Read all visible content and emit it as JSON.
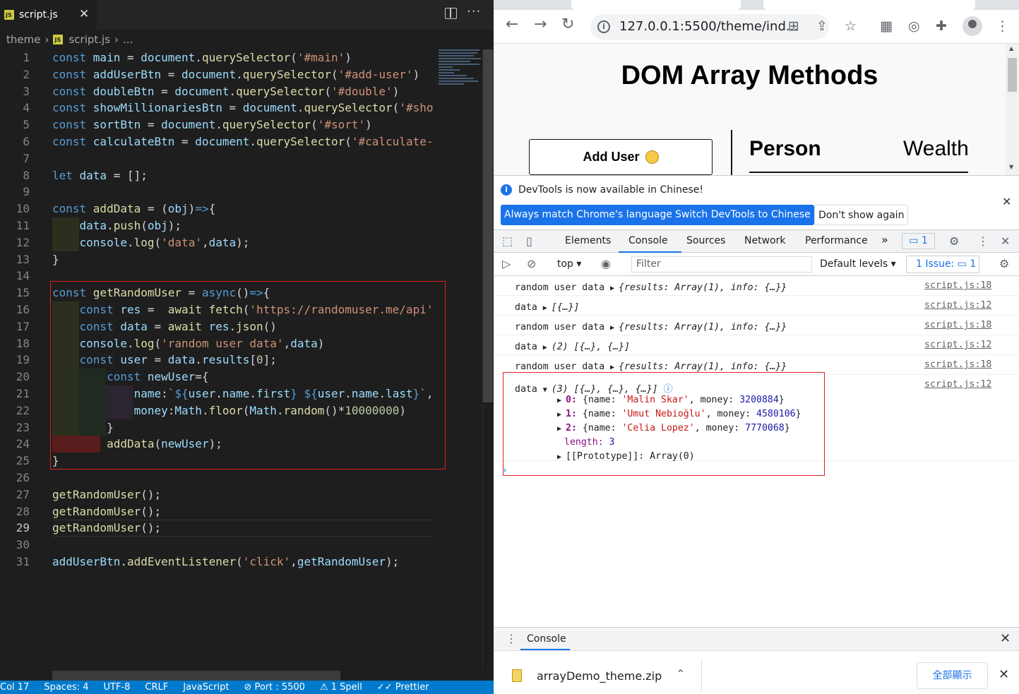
{
  "editor": {
    "tab": {
      "icon": "JS",
      "label": "script.js",
      "close": "✕"
    },
    "breadcrumb": {
      "folder": "theme",
      "file": "script.js",
      "more": "..."
    },
    "current_line": 29,
    "lines": [
      [
        [
          "k",
          "const "
        ],
        [
          "v",
          "main"
        ],
        [
          "p",
          " = "
        ],
        [
          "v",
          "document"
        ],
        [
          "p",
          "."
        ],
        [
          "f",
          "querySelector"
        ],
        [
          "p",
          "("
        ],
        [
          "s",
          "'#main'"
        ],
        [
          "p",
          ")"
        ]
      ],
      [
        [
          "k",
          "const "
        ],
        [
          "v",
          "addUserBtn"
        ],
        [
          "p",
          " = "
        ],
        [
          "v",
          "document"
        ],
        [
          "p",
          "."
        ],
        [
          "f",
          "querySelector"
        ],
        [
          "p",
          "("
        ],
        [
          "s",
          "'#add-user'"
        ],
        [
          "p",
          ")"
        ]
      ],
      [
        [
          "k",
          "const "
        ],
        [
          "v",
          "doubleBtn"
        ],
        [
          "p",
          " = "
        ],
        [
          "v",
          "document"
        ],
        [
          "p",
          "."
        ],
        [
          "f",
          "querySelector"
        ],
        [
          "p",
          "("
        ],
        [
          "s",
          "'#double'"
        ],
        [
          "p",
          ")"
        ]
      ],
      [
        [
          "k",
          "const "
        ],
        [
          "v",
          "showMillionariesBtn"
        ],
        [
          "p",
          " = "
        ],
        [
          "v",
          "document"
        ],
        [
          "p",
          "."
        ],
        [
          "f",
          "querySelector"
        ],
        [
          "p",
          "("
        ],
        [
          "s",
          "'#show"
        ]
      ],
      [
        [
          "k",
          "const "
        ],
        [
          "v",
          "sortBtn"
        ],
        [
          "p",
          " = "
        ],
        [
          "v",
          "document"
        ],
        [
          "p",
          "."
        ],
        [
          "f",
          "querySelector"
        ],
        [
          "p",
          "("
        ],
        [
          "s",
          "'#sort'"
        ],
        [
          "p",
          ")"
        ]
      ],
      [
        [
          "k",
          "const "
        ],
        [
          "v",
          "calculateBtn"
        ],
        [
          "p",
          " = "
        ],
        [
          "v",
          "document"
        ],
        [
          "p",
          "."
        ],
        [
          "f",
          "querySelector"
        ],
        [
          "p",
          "("
        ],
        [
          "s",
          "'#calculate-"
        ]
      ],
      [],
      [
        [
          "k",
          "let "
        ],
        [
          "v",
          "data"
        ],
        [
          "p",
          " = [];"
        ]
      ],
      [],
      [
        [
          "k",
          "const "
        ],
        [
          "f",
          "addData"
        ],
        [
          "p",
          " = ("
        ],
        [
          "v",
          "obj"
        ],
        [
          "p",
          ")"
        ],
        [
          "k",
          "=>"
        ],
        [
          "p",
          "{"
        ]
      ],
      [
        [
          "p",
          "    "
        ],
        [
          "v",
          "data"
        ],
        [
          "p",
          "."
        ],
        [
          "f",
          "push"
        ],
        [
          "p",
          "("
        ],
        [
          "v",
          "obj"
        ],
        [
          "p",
          ");"
        ]
      ],
      [
        [
          "p",
          "    "
        ],
        [
          "v",
          "console"
        ],
        [
          "p",
          "."
        ],
        [
          "f",
          "log"
        ],
        [
          "p",
          "("
        ],
        [
          "s",
          "'data'"
        ],
        [
          "p",
          ","
        ],
        [
          "v",
          "data"
        ],
        [
          "p",
          ");"
        ]
      ],
      [
        [
          "p",
          "}"
        ]
      ],
      [],
      [
        [
          "k",
          "const "
        ],
        [
          "f",
          "getRandomUser"
        ],
        [
          "p",
          " = "
        ],
        [
          "k",
          "async"
        ],
        [
          "p",
          "()"
        ],
        [
          "k",
          "=>"
        ],
        [
          "p",
          "{"
        ]
      ],
      [
        [
          "p",
          "    "
        ],
        [
          "k",
          "const "
        ],
        [
          "v",
          "res"
        ],
        [
          "p",
          " =  "
        ],
        [
          "f",
          "await "
        ],
        [
          "f",
          "fetch"
        ],
        [
          "p",
          "("
        ],
        [
          "s",
          "'https://randomuser.me/api'"
        ]
      ],
      [
        [
          "p",
          "    "
        ],
        [
          "k",
          "const "
        ],
        [
          "v",
          "data"
        ],
        [
          "p",
          " = "
        ],
        [
          "f",
          "await "
        ],
        [
          "v",
          "res"
        ],
        [
          "p",
          "."
        ],
        [
          "f",
          "json"
        ],
        [
          "p",
          "()"
        ]
      ],
      [
        [
          "p",
          "    "
        ],
        [
          "v",
          "console"
        ],
        [
          "p",
          "."
        ],
        [
          "f",
          "log"
        ],
        [
          "p",
          "("
        ],
        [
          "s",
          "'random user data'"
        ],
        [
          "p",
          ","
        ],
        [
          "v",
          "data"
        ],
        [
          "p",
          ")"
        ]
      ],
      [
        [
          "p",
          "    "
        ],
        [
          "k",
          "const "
        ],
        [
          "v",
          "user"
        ],
        [
          "p",
          " = "
        ],
        [
          "v",
          "data"
        ],
        [
          "p",
          "."
        ],
        [
          "v",
          "results"
        ],
        [
          "p",
          "["
        ],
        [
          "n",
          "0"
        ],
        [
          "p",
          "];"
        ]
      ],
      [
        [
          "p",
          "        "
        ],
        [
          "k",
          "const "
        ],
        [
          "v",
          "newUser"
        ],
        [
          "p",
          "={"
        ]
      ],
      [
        [
          "p",
          "            "
        ],
        [
          "v",
          "name"
        ],
        [
          "p",
          ":"
        ],
        [
          "s",
          "`"
        ],
        [
          "k",
          "${"
        ],
        [
          "v",
          "user"
        ],
        [
          "p",
          "."
        ],
        [
          "v",
          "name"
        ],
        [
          "p",
          "."
        ],
        [
          "v",
          "first"
        ],
        [
          "k",
          "}"
        ],
        [
          "s",
          " "
        ],
        [
          "k",
          "${"
        ],
        [
          "v",
          "user"
        ],
        [
          "p",
          "."
        ],
        [
          "v",
          "name"
        ],
        [
          "p",
          "."
        ],
        [
          "v",
          "last"
        ],
        [
          "k",
          "}"
        ],
        [
          "s",
          "`"
        ],
        [
          "p",
          ","
        ]
      ],
      [
        [
          "p",
          "            "
        ],
        [
          "v",
          "money"
        ],
        [
          "p",
          ":"
        ],
        [
          "v",
          "Math"
        ],
        [
          "p",
          "."
        ],
        [
          "f",
          "floor"
        ],
        [
          "p",
          "("
        ],
        [
          "v",
          "Math"
        ],
        [
          "p",
          "."
        ],
        [
          "f",
          "random"
        ],
        [
          "p",
          "()*"
        ],
        [
          "n",
          "10000000"
        ],
        [
          "p",
          ")"
        ]
      ],
      [
        [
          "p",
          "        }"
        ]
      ],
      [
        [
          "p",
          "        "
        ],
        [
          "f",
          "addData"
        ],
        [
          "p",
          "("
        ],
        [
          "v",
          "newUser"
        ],
        [
          "p",
          ");"
        ]
      ],
      [
        [
          "p",
          "}"
        ]
      ],
      [],
      [
        [
          "f",
          "getRandomUser"
        ],
        [
          "p",
          "();"
        ]
      ],
      [
        [
          "f",
          "getRandomUser"
        ],
        [
          "p",
          "();"
        ]
      ],
      [
        [
          "f",
          "getRandomUser"
        ],
        [
          "p",
          "();"
        ]
      ],
      [],
      [
        [
          "v",
          "addUserBtn"
        ],
        [
          "p",
          "."
        ],
        [
          "f",
          "addEventListener"
        ],
        [
          "p",
          "("
        ],
        [
          "s",
          "'click'"
        ],
        [
          "p",
          ","
        ],
        [
          "v",
          "getRandomUser"
        ],
        [
          "p",
          ");"
        ]
      ]
    ]
  },
  "statusbar": [
    "Col 17",
    "Spaces: 4",
    "UTF-8",
    "CRLF",
    "JavaScript",
    "⊘ Port : 5500",
    "⚠ 1 Spell",
    "✓✓ Prettier"
  ],
  "browser": {
    "url": "127.0.0.1:5500/theme/ind...",
    "page": {
      "title": "DOM Array Methods",
      "add_user": "Add User",
      "col_person": "Person",
      "col_wealth": "Wealth"
    }
  },
  "devtools": {
    "notice": "DevTools is now available in Chinese!",
    "btn_match": "Always match Chrome's language",
    "btn_switch": "Switch DevTools to Chinese",
    "btn_dont": "Don't show again",
    "tabs": [
      "Elements",
      "Console",
      "Sources",
      "Network",
      "Performance"
    ],
    "more_tabs": "»",
    "msg_count": "1",
    "context": "top",
    "filter_placeholder": "Filter",
    "levels": "Default levels",
    "issues": "1 Issue:",
    "issues_count": "1",
    "log": [
      {
        "label": "random user data",
        "value": "{results: Array(1), info: {…}}",
        "src": "script.js:18"
      },
      {
        "label": "data",
        "value": "[{…}]",
        "src": "script.js:12"
      },
      {
        "label": "random user data",
        "value": "{results: Array(1), info: {…}}",
        "src": "script.js:18"
      },
      {
        "label": "data",
        "value": "(2) [{…}, {…}]",
        "src": "script.js:12"
      },
      {
        "label": "random user data",
        "value": "{results: Array(1), info: {…}}",
        "src": "script.js:18"
      },
      {
        "label": "data",
        "value": "(3) [{…}, {…}, {…}]",
        "src": "script.js:12"
      }
    ],
    "expanded": [
      {
        "key": "0",
        "name": "'Malin Skar'",
        "money": "3200884"
      },
      {
        "key": "1",
        "name": "'Umut Nebioğlu'",
        "money": "4580106"
      },
      {
        "key": "2",
        "name": "'Celia Lopez'",
        "money": "7770068"
      }
    ],
    "length_key": "length",
    "length_val": "3",
    "prototype": "[[Prototype]]: Array(0)",
    "drawer": "Console",
    "download": {
      "file": "arrayDemo_theme.zip",
      "show_all": "全部顯示"
    }
  }
}
